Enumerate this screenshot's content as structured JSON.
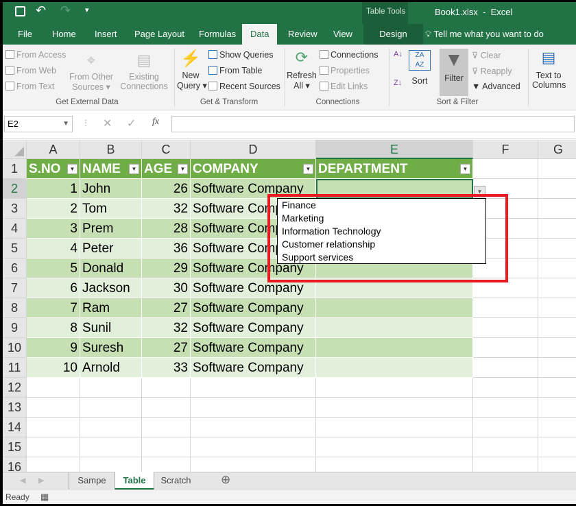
{
  "window": {
    "file_title": "Book1.xlsx  -  Excel",
    "context_tab": "Table Tools"
  },
  "menu_tabs": [
    "File",
    "Home",
    "Insert",
    "Page Layout",
    "Formulas",
    "Data",
    "Review",
    "View",
    "Design"
  ],
  "active_tab": "Data",
  "tell_me": "Tell me what you want to do",
  "ribbon": {
    "get_external": {
      "from_access": "From Access",
      "from_web": "From Web",
      "from_text": "From Text",
      "from_other": "From Other",
      "sources": "Sources",
      "existing": "Existing",
      "connections": "Connections",
      "label": "Get External Data"
    },
    "transform": {
      "new": "New",
      "query": "Query",
      "show_queries": "Show Queries",
      "from_table": "From Table",
      "recent_sources": "Recent Sources",
      "label": "Get & Transform"
    },
    "connections": {
      "refresh": "Refresh",
      "all": "All",
      "connections": "Connections",
      "properties": "Properties",
      "edit_links": "Edit Links",
      "label": "Connections"
    },
    "sort_filter": {
      "sort": "Sort",
      "filter": "Filter",
      "clear": "Clear",
      "reapply": "Reapply",
      "advanced": "Advanced",
      "label": "Sort & Filter"
    },
    "text_to": "Text to",
    "columns": "Columns"
  },
  "name_box": "E2",
  "formula": "",
  "columns": [
    "A",
    "B",
    "C",
    "D",
    "E",
    "F",
    "G"
  ],
  "headers": [
    "S.NO",
    "NAME",
    "AGE",
    "COMPANY",
    "DEPARTMENT"
  ],
  "rows": [
    [
      "1",
      "John",
      "26",
      "Software Company",
      ""
    ],
    [
      "2",
      "Tom",
      "32",
      "Software Company",
      ""
    ],
    [
      "3",
      "Prem",
      "28",
      "Software Company",
      ""
    ],
    [
      "4",
      "Peter",
      "36",
      "Software Company",
      ""
    ],
    [
      "5",
      "Donald",
      "29",
      "Software Company",
      ""
    ],
    [
      "6",
      "Jackson",
      "30",
      "Software Company",
      ""
    ],
    [
      "7",
      "Ram",
      "27",
      "Software Company",
      ""
    ],
    [
      "8",
      "Sunil",
      "32",
      "Software Company",
      ""
    ],
    [
      "9",
      "Suresh",
      "27",
      "Software Company",
      ""
    ],
    [
      "10",
      "Arnold",
      "33",
      "Software Company",
      ""
    ]
  ],
  "row_numbers": [
    "1",
    "2",
    "3",
    "4",
    "5",
    "6",
    "7",
    "8",
    "9",
    "10",
    "11",
    "12",
    "13",
    "14",
    "15",
    "16"
  ],
  "dropdown_options": [
    "Finance",
    "Marketing",
    "Information Technology",
    "Customer relationship",
    "Support services"
  ],
  "sheets": [
    "Sampe",
    "Table",
    "Scratch"
  ],
  "active_sheet": "Table",
  "status": "Ready",
  "colors": {
    "brand": "#217346",
    "table_header": "#70ad47",
    "band_dark": "#c6e0b4",
    "band_light": "#e2efda",
    "highlight": "#e81b23"
  }
}
